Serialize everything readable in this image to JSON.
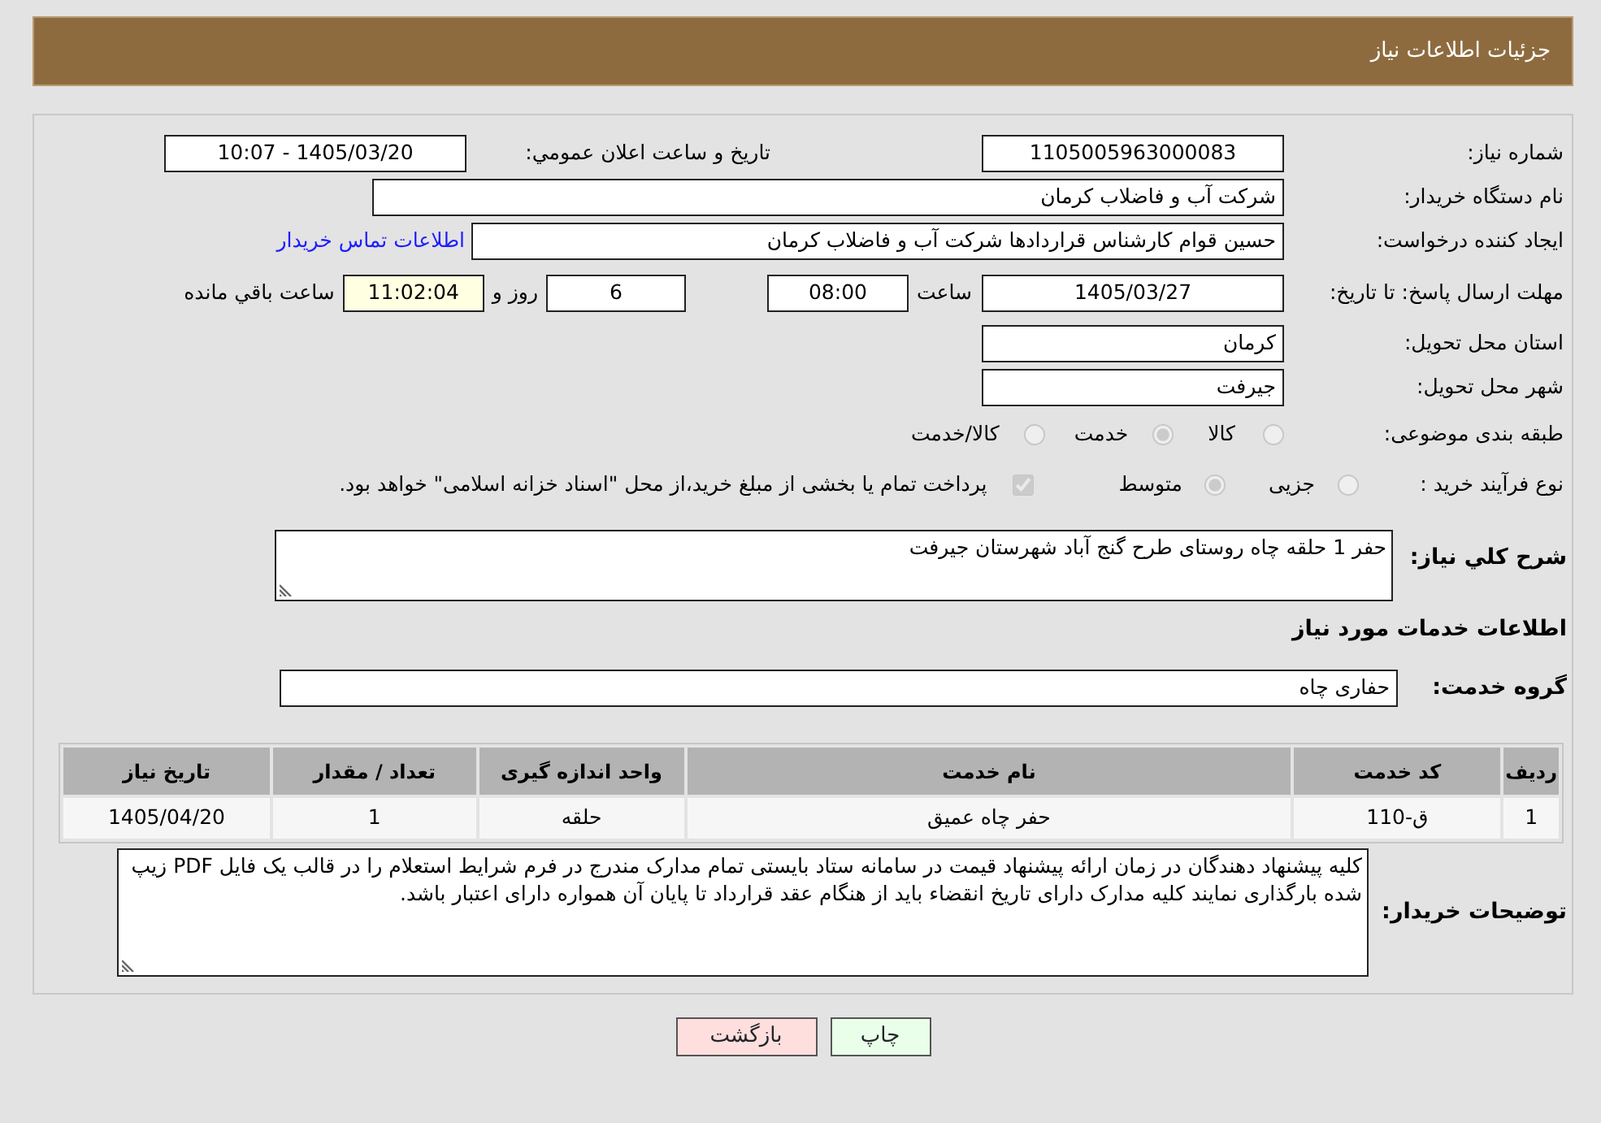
{
  "header": {
    "title": "جزئیات اطلاعات نیاز"
  },
  "need_number": {
    "label": "شماره نیاز:",
    "value": "1105005963000083"
  },
  "announce_datetime": {
    "label": "تاریخ و ساعت اعلان عمومي:",
    "value": "1405/03/20 - 10:07"
  },
  "buyer_org": {
    "label": "نام دستگاه خریدار:",
    "value": "شرکت آب و فاضلاب کرمان"
  },
  "requester": {
    "label": "ایجاد کننده درخواست:",
    "value": "حسین قوام کارشناس قراردادها شرکت آب و فاضلاب کرمان",
    "link": "اطلاعات تماس خریدار"
  },
  "deadline": {
    "label": "مهلت ارسال پاسخ: تا تاریخ:",
    "date": "1405/03/27",
    "time_label": "ساعت",
    "time": "08:00",
    "days": "6",
    "days_label": "روز و",
    "remaining": "11:02:04",
    "remaining_label": "ساعت باقي مانده"
  },
  "province": {
    "label": "استان محل تحویل:",
    "value": "کرمان"
  },
  "city": {
    "label": "شهر محل تحویل:",
    "value": "جیرفت"
  },
  "category": {
    "label": "طبقه بندی موضوعی:",
    "options": [
      {
        "label": "کالا",
        "selected": false
      },
      {
        "label": "خدمت",
        "selected": true
      },
      {
        "label": "کالا/خدمت",
        "selected": false
      }
    ]
  },
  "process": {
    "label": "نوع فرآیند خرید :",
    "options": [
      {
        "label": "جزیی",
        "selected": false
      },
      {
        "label": "متوسط",
        "selected": true
      }
    ],
    "treasury": {
      "label": "پرداخت تمام یا بخشی از مبلغ خرید،از محل \"اسناد خزانه اسلامی\" خواهد بود.",
      "checked": true
    }
  },
  "description": {
    "label": "شرح کلي نیاز:",
    "value": "حفر 1 حلقه چاه روستای طرح گنج آباد شهرستان جیرفت"
  },
  "services_title": "اطلاعات خدمات مورد نیاز",
  "service_group": {
    "label": "گروه خدمت:",
    "value": "حفاری چاه"
  },
  "table": {
    "columns": [
      "ردیف",
      "کد خدمت",
      "نام خدمت",
      "واحد اندازه گیری",
      "تعداد / مقدار",
      "تاریخ نیاز"
    ],
    "rows": [
      [
        "1",
        "ق-110",
        "حفر چاه عمیق",
        "حلقه",
        "1",
        "1405/04/20"
      ]
    ]
  },
  "buyer_notes": {
    "label": "توضیحات خریدار:",
    "value": "کلیه پیشنهاد دهندگان در زمان ارائه پیشنهاد قیمت در سامانه ستاد بایستی تمام مدارک مندرج در فرم شرایط استعلام را در قالب یک فایل PDF زیپ شده بارگذاری نمایند کلیه مدارک دارای تاریخ انقضاء باید از هنگام عقد قرارداد تا پایان آن همواره دارای اعتبار باشد."
  },
  "buttons": [
    {
      "label": "چاپ",
      "kind": "print"
    },
    {
      "label": "بازگشت",
      "kind": "back"
    }
  ]
}
